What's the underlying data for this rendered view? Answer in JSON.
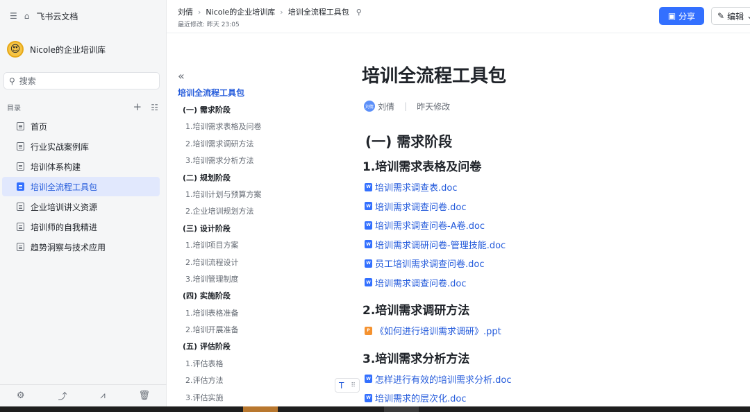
{
  "app": {
    "menu_icon": "collapse-menu-icon",
    "home_icon": "home-icon",
    "name": "飞书云文档"
  },
  "space": {
    "emoji": "😍",
    "name": "Nicole的企业培训库"
  },
  "search": {
    "placeholder": "搜索"
  },
  "toc_header": {
    "label": "目录",
    "add_icon": "plus-icon",
    "list_icon": "list-icon"
  },
  "nav": [
    {
      "label": "首页",
      "active": false
    },
    {
      "label": "行业实战案例库",
      "active": false
    },
    {
      "label": "培训体系构建",
      "active": false
    },
    {
      "label": "培训全流程工具包",
      "active": true
    },
    {
      "label": "企业培训讲义资源",
      "active": false
    },
    {
      "label": "培训师的自我精进",
      "active": false
    },
    {
      "label": "趋势洞察与技术应用",
      "active": false
    }
  ],
  "bottom_icons": [
    "settings-icon",
    "share-out-icon",
    "stats-icon",
    "trash-icon"
  ],
  "breadcrumb": {
    "items": [
      "刘倩",
      "Nicole的企业培训库",
      "培训全流程工具包"
    ],
    "pin_icon": "pin-icon"
  },
  "last_modified": "最近修改: 昨天 23:05",
  "buttons": {
    "share": "分享",
    "edit": "编辑"
  },
  "outline": {
    "title": "培训全流程工具包",
    "entries": [
      {
        "type": "sec",
        "text": "(一) 需求阶段"
      },
      {
        "type": "sub",
        "text": "1.培训需求表格及问卷"
      },
      {
        "type": "sub",
        "text": "2.培训需求调研方法"
      },
      {
        "type": "sub",
        "text": "3.培训需求分析方法"
      },
      {
        "type": "sec",
        "text": "(二) 规划阶段"
      },
      {
        "type": "sub",
        "text": "1.培训计划与预算方案"
      },
      {
        "type": "sub",
        "text": "2.企业培训规划方法"
      },
      {
        "type": "sec",
        "text": "(三) 设计阶段"
      },
      {
        "type": "sub",
        "text": "1.培训项目方案"
      },
      {
        "type": "sub",
        "text": "2.培训流程设计"
      },
      {
        "type": "sub",
        "text": "3.培训管理制度"
      },
      {
        "type": "sec",
        "text": "(四) 实施阶段"
      },
      {
        "type": "sub",
        "text": "1.培训表格准备"
      },
      {
        "type": "sub",
        "text": "2.培训开展准备"
      },
      {
        "type": "sec",
        "text": "(五) 评估阶段"
      },
      {
        "type": "sub",
        "text": "1.评估表格"
      },
      {
        "type": "sub",
        "text": "2.评估方法"
      },
      {
        "type": "sub",
        "text": "3.评估实施"
      }
    ]
  },
  "doc": {
    "title": "培训全流程工具包",
    "author": "刘倩",
    "author_avatar": "刘倩",
    "modified": "昨天修改",
    "section": "(一) 需求阶段",
    "h3_1": "1.培训需求表格及问卷",
    "files_1": [
      "培训需求调查表.doc",
      "培训需求调查问卷.doc",
      "培训需求调查问卷-A卷.doc",
      "培训需求调研问卷-管理技能.doc",
      "员工培训需求调查问卷.doc",
      "培训需求调查问卷.doc"
    ],
    "h3_2": "2.培训需求调研方法",
    "files_2": [
      "《如何进行培训需求调研》.ppt"
    ],
    "h3_3": "3.培训需求分析方法",
    "files_3": [
      "怎样进行有效的培训需求分析.doc",
      "培训需求的层次化.doc"
    ],
    "file_badge_doc": "W",
    "file_badge_ppt": "P"
  },
  "block_tool": {
    "text_icon": "T",
    "drag_icon": "⠿"
  },
  "colors": {
    "accent": "#3370ff",
    "link": "#245bdb",
    "active_bg": "#e1e8fd"
  }
}
